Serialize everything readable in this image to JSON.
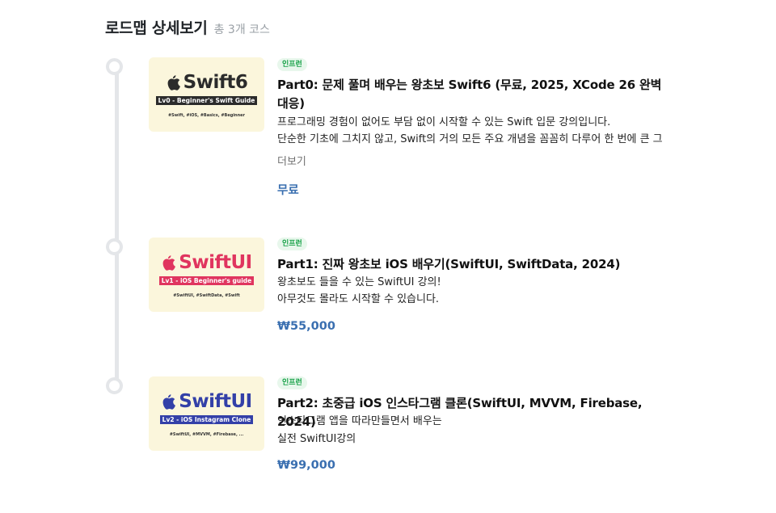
{
  "header": {
    "title": "로드맵 상세보기",
    "count": "총 3개 코스"
  },
  "courses": [
    {
      "thumb": {
        "logo": "Swift6",
        "subtitle": "Lv0 - Beginner's Swift Guide",
        "tags": "#Swift, #iOS, #Basics, #Beginner",
        "logo_color": "#2b2b2b",
        "subtitle_bg": "#2b2b2b"
      },
      "badge": "인프런",
      "title": "Part0: 문제 풀며 배우는 왕초보 Swift6 (무료, 2025, XCode 26 완벽 대응)",
      "desc": [
        "프로그래밍 경험이 없어도 부담 없이 시작할 수 있는 Swift 입문 강의입니다.",
        "단순한 기초에 그치지 않고, Swift의 거의 모든 주요 개념을 꼼꼼히 다루어 한 번에 큰 그"
      ],
      "more": "더보기",
      "price": "무료"
    },
    {
      "thumb": {
        "logo": "SwiftUI",
        "subtitle": "Lv1 - iOS Beginner's guide",
        "tags": "#SwiftUI, #SwiftData, #Swift",
        "logo_color": "#e0355f",
        "subtitle_bg": "#e0355f"
      },
      "badge": "인프런",
      "title": "Part1: 진짜 왕초보 iOS 배우기(SwiftUI, SwiftData, 2024)",
      "desc": [
        "왕초보도 들을 수 있는 SwiftUI 강의!",
        "아무것도 몰라도 시작할 수 있습니다."
      ],
      "price": "₩55,000"
    },
    {
      "thumb": {
        "logo": "SwiftUI",
        "subtitle": "Lv2 - iOS Instagram Clone",
        "tags": "#SwiftUI, #MVVM, #Firebase, ...",
        "logo_color": "#3340a8",
        "subtitle_bg": "#3340a8"
      },
      "badge": "인프런",
      "title": "Part2: 초중급 iOS 인스타그램 클론(SwiftUI, MVVM, Firebase, 2024)",
      "desc": [
        "인스타그램 앱을 따라만들면서 배우는",
        "실전 SwiftUI강의"
      ],
      "price": "₩99,000"
    }
  ]
}
